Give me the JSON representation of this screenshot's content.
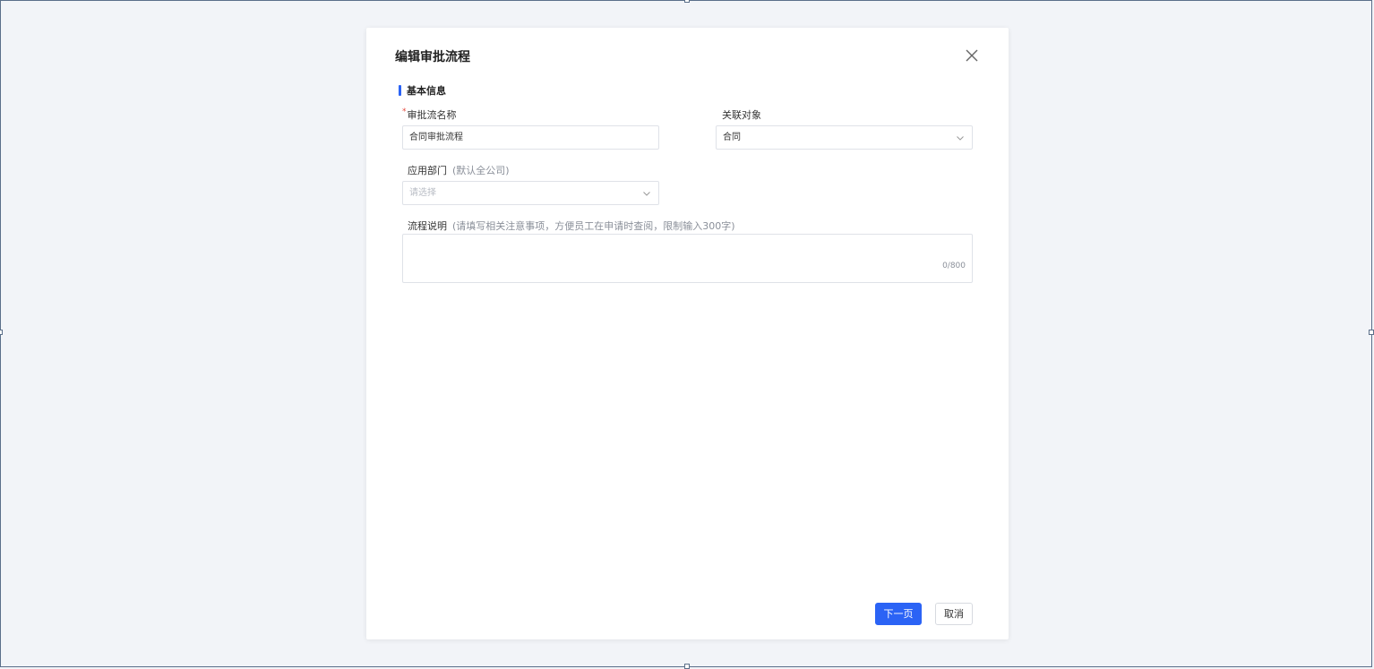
{
  "modal": {
    "title": "编辑审批流程",
    "close_icon": "close-icon",
    "section_title": "基本信息"
  },
  "form": {
    "name": {
      "required_mark": "*",
      "label": "审批流名称",
      "value": "合同审批流程"
    },
    "related_object": {
      "label": "关联对象",
      "value": "合同",
      "icon": "chevron-down-icon"
    },
    "department": {
      "label": "应用部门",
      "hint": "(默认全公司)",
      "placeholder": "请选择",
      "icon": "chevron-down-icon"
    },
    "description": {
      "label": "流程说明",
      "hint": "(请填写相关注意事项，方便员工在申请时查阅，限制输入300字)",
      "value": "",
      "counter": "0/800"
    }
  },
  "footer": {
    "next_label": "下一页",
    "cancel_label": "取消"
  },
  "colors": {
    "accent": "#2b63f5",
    "required": "#e5483d",
    "page_background": "#f2f4f8"
  }
}
